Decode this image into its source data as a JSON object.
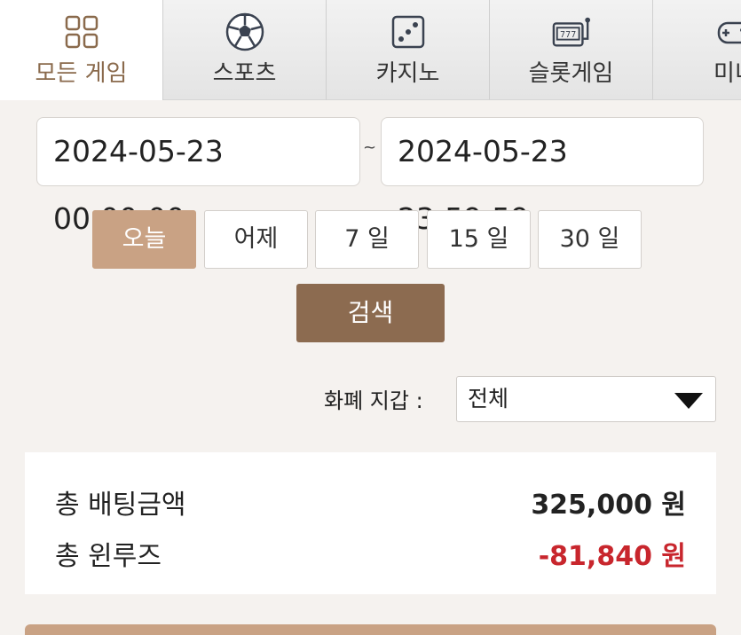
{
  "tabs": [
    {
      "label": "모든 게임",
      "icon": "grid-icon",
      "active": true
    },
    {
      "label": "스포츠",
      "icon": "soccer-ball-icon",
      "active": false
    },
    {
      "label": "카지노",
      "icon": "dice-icon",
      "active": false
    },
    {
      "label": "슬롯게임",
      "icon": "slot-machine-icon",
      "active": false
    },
    {
      "label": "미니",
      "icon": "gamepad-icon",
      "active": false
    }
  ],
  "date_range": {
    "from": "2024-05-23 00:00:00",
    "separator": "~",
    "to": "2024-05-23 23:59:59"
  },
  "quick_ranges": [
    "오늘",
    "어제",
    "7 일",
    "15 일",
    "30 일"
  ],
  "search_label": "검색",
  "wallet": {
    "label": "화폐 지갑 :",
    "selected": "전체"
  },
  "summary": {
    "total_bet_label": "총 배팅금액",
    "total_bet_value": "325,000 원",
    "total_winloss_label": "총 윈루즈",
    "total_winloss_value": "-81,840 원"
  },
  "colors": {
    "accent": "#c9a284",
    "search": "#8c6b50",
    "negative": "#c8262d"
  }
}
